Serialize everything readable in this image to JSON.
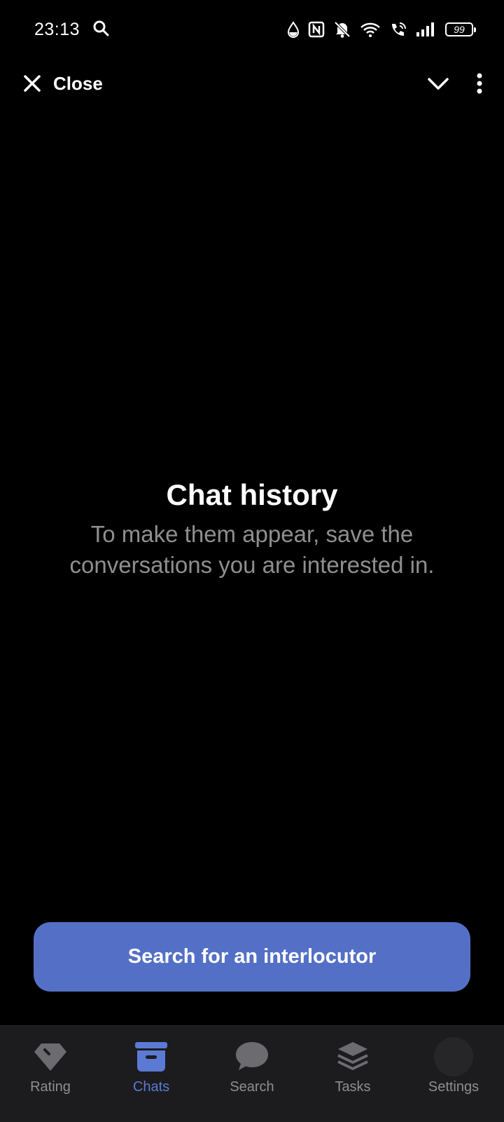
{
  "status_bar": {
    "time": "23:13",
    "battery": "99",
    "icons": [
      "search-icon",
      "drop-icon",
      "nfc-icon",
      "bell-off-icon",
      "wifi-icon",
      "wifi-call-icon",
      "signal-icon",
      "battery-icon"
    ]
  },
  "app_bar": {
    "close_label": "Close",
    "icons": [
      "close-icon",
      "chevron-down-icon",
      "more-vertical-icon"
    ]
  },
  "empty_state": {
    "title": "Chat history",
    "subtitle": "To make them appear, save the conversations you are interested in."
  },
  "primary_action": {
    "label": "Search for an interlocutor"
  },
  "bottom_nav": {
    "active": "Chats",
    "items": [
      {
        "label": "Rating",
        "icon": "diamond-icon"
      },
      {
        "label": "Chats",
        "icon": "archive-icon"
      },
      {
        "label": "Search",
        "icon": "chat-bubble-icon"
      },
      {
        "label": "Tasks",
        "icon": "layers-icon"
      },
      {
        "label": "Settings",
        "icon": "avatar-icon"
      }
    ]
  },
  "colors": {
    "background": "#000000",
    "accent": "#5470c6",
    "nav_active": "#5b7ad4",
    "nav_inactive": "#8e8e93",
    "subtitle": "#8f8f8f",
    "nav_background": "#1c1c1e"
  }
}
